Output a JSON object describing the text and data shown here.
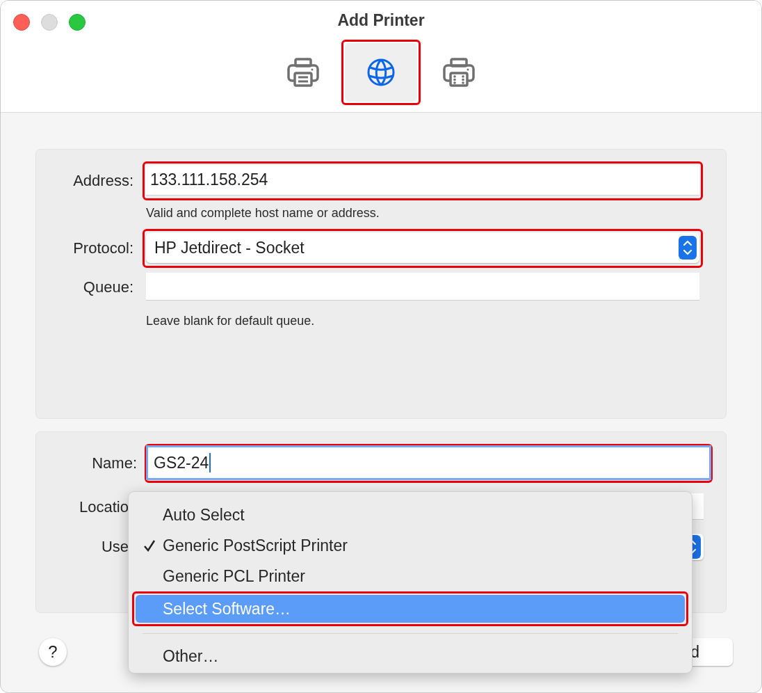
{
  "window": {
    "title": "Add Printer"
  },
  "toolbar": [
    {
      "kind": "printer",
      "selected": false,
      "annotated": false
    },
    {
      "kind": "globe",
      "selected": true,
      "annotated": true
    },
    {
      "kind": "printer-grid",
      "selected": false,
      "annotated": false
    }
  ],
  "connection": {
    "address": {
      "label": "Address:",
      "value": "133.111.158.254",
      "annotated": true
    },
    "address_hint": "Valid and complete host name or address.",
    "protocol": {
      "label": "Protocol:",
      "value": "HP Jetdirect - Socket",
      "annotated": true
    },
    "queue": {
      "label": "Queue:"
    },
    "queue_hint": "Leave blank for default queue."
  },
  "details": {
    "name": {
      "label": "Name:",
      "value": "GS2-24",
      "focused": true,
      "annotated": true
    },
    "location": {
      "label": "Locatio"
    },
    "use": {
      "label": "Use"
    }
  },
  "menu": {
    "items": [
      {
        "kind": "item",
        "label": "Auto Select",
        "checked": false,
        "selected": false,
        "annotated": false
      },
      {
        "kind": "item",
        "label": "Generic PostScript Printer",
        "checked": true,
        "selected": false,
        "annotated": false
      },
      {
        "kind": "item",
        "label": "Generic PCL Printer",
        "checked": false,
        "selected": false,
        "annotated": false
      },
      {
        "kind": "item",
        "label": "Select Software…",
        "checked": false,
        "selected": true,
        "annotated": true
      },
      {
        "kind": "separator"
      },
      {
        "kind": "item",
        "label": "Other…",
        "checked": false,
        "selected": false,
        "annotated": false
      }
    ]
  },
  "footer": {
    "help": "?",
    "add_button": "d"
  }
}
